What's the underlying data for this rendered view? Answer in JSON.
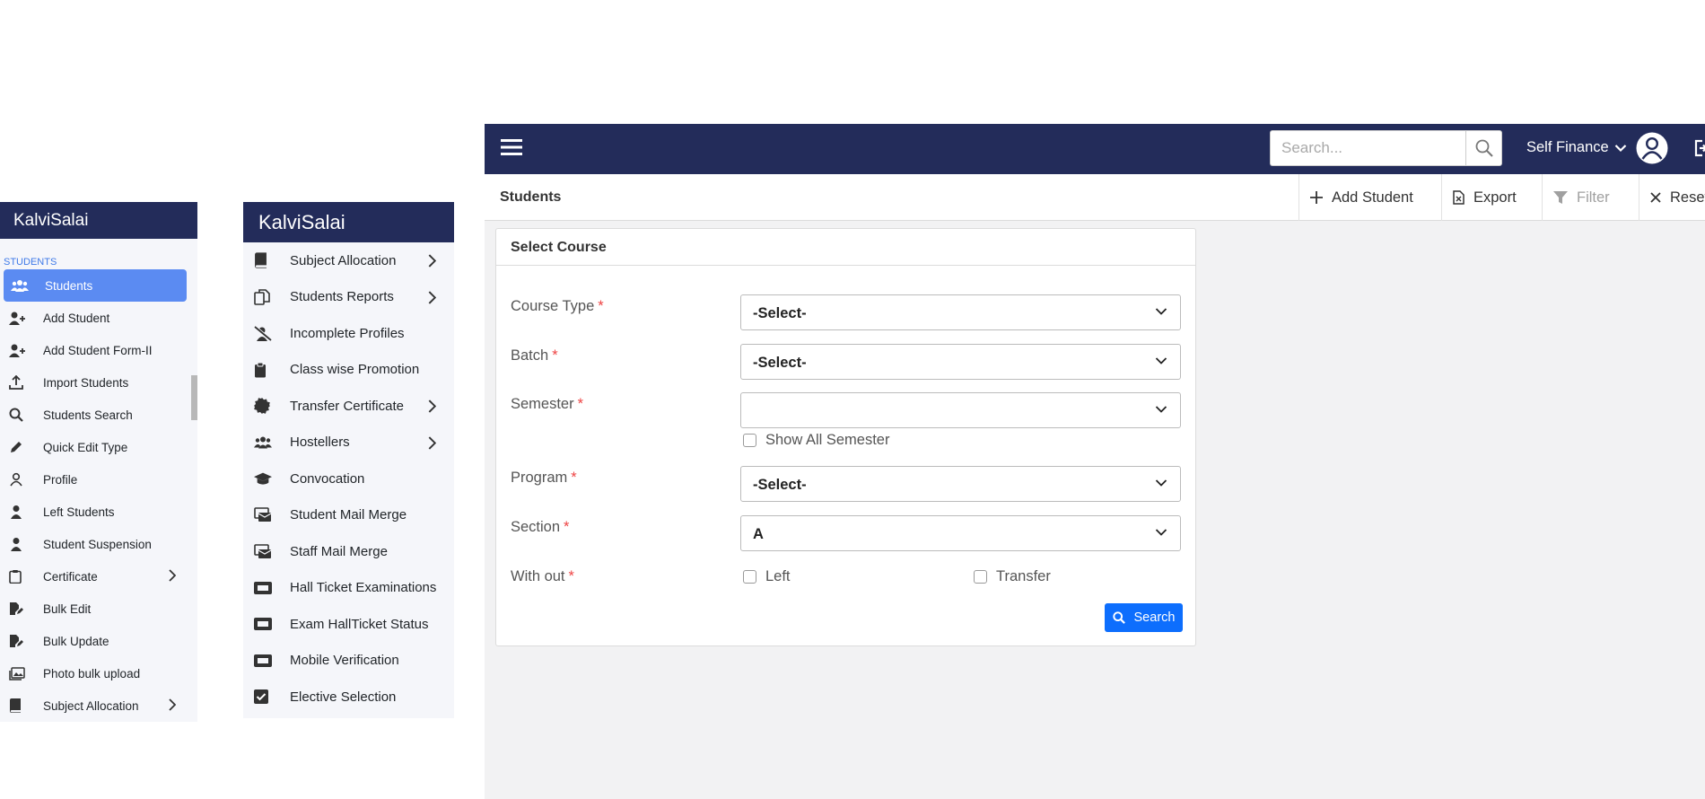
{
  "sidebar1": {
    "brand": "KalviSalai",
    "section": "STUDENTS",
    "items": [
      {
        "label": "Students",
        "icon": "users-icon",
        "active": true
      },
      {
        "label": "Add Student",
        "icon": "user-plus-icon"
      },
      {
        "label": "Add Student Form-II",
        "icon": "user-plus-icon"
      },
      {
        "label": "Import Students",
        "icon": "upload-icon"
      },
      {
        "label": "Students Search",
        "icon": "search-icon"
      },
      {
        "label": "Quick Edit Type",
        "icon": "pencil-icon"
      },
      {
        "label": "Profile",
        "icon": "user-outline-icon"
      },
      {
        "label": "Left Students",
        "icon": "user-icon"
      },
      {
        "label": "Student Suspension",
        "icon": "user-icon"
      },
      {
        "label": "Certificate",
        "icon": "clipboard-icon",
        "submenu": true
      },
      {
        "label": "Bulk Edit",
        "icon": "file-edit-icon"
      },
      {
        "label": "Bulk Update",
        "icon": "file-edit-icon"
      },
      {
        "label": "Photo bulk upload",
        "icon": "images-icon"
      },
      {
        "label": "Subject Allocation",
        "icon": "book-icon",
        "submenu": true
      }
    ]
  },
  "sidebar2": {
    "brand": "KalviSalai",
    "items": [
      {
        "label": "Subject Allocation",
        "icon": "book-icon",
        "submenu": true
      },
      {
        "label": "Students Reports",
        "icon": "copy-icon",
        "submenu": true
      },
      {
        "label": "Incomplete Profiles",
        "icon": "user-slash-icon"
      },
      {
        "label": "Class wise Promotion",
        "icon": "clipboard-icon"
      },
      {
        "label": "Transfer Certificate",
        "icon": "certificate-icon",
        "submenu": true
      },
      {
        "label": "Hostellers",
        "icon": "users-icon",
        "submenu": true
      },
      {
        "label": "Convocation",
        "icon": "graduation-cap-icon"
      },
      {
        "label": "Student Mail Merge",
        "icon": "mail-bulk-icon"
      },
      {
        "label": "Staff Mail Merge",
        "icon": "mail-bulk-icon"
      },
      {
        "label": "Hall Ticket Examinations",
        "icon": "ticket-icon"
      },
      {
        "label": "Exam HallTicket Status",
        "icon": "ticket-icon"
      },
      {
        "label": "Mobile Verification",
        "icon": "ticket-icon"
      },
      {
        "label": "Elective Selection",
        "icon": "check-square-icon"
      }
    ]
  },
  "header": {
    "search_placeholder": "Search...",
    "finance_label": "Self Finance"
  },
  "subbar": {
    "title": "Students",
    "add_student": "Add Student",
    "export": "Export",
    "filter": "Filter",
    "reset": "Reset"
  },
  "form": {
    "card_title": "Select Course",
    "fields": {
      "course_type": {
        "label": "Course Type",
        "value": "-Select-"
      },
      "batch": {
        "label": "Batch",
        "value": "-Select-"
      },
      "semester": {
        "label": "Semester",
        "value": ""
      },
      "program": {
        "label": "Program",
        "value": "-Select-"
      },
      "section": {
        "label": "Section",
        "value": "A"
      },
      "without": {
        "label": "With out"
      }
    },
    "show_all_semester": "Show All Semester",
    "left": "Left",
    "transfer": "Transfer",
    "required_mark": "*",
    "search_button": "Search"
  },
  "colors": {
    "navy": "#232c5a",
    "active_item": "#5b8bf2",
    "primary_button": "#0d6efd",
    "required": "#e44444"
  }
}
